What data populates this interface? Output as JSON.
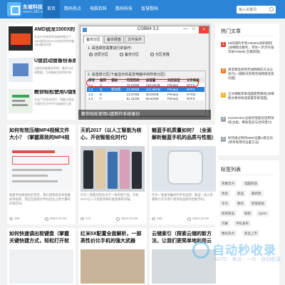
{
  "header": {
    "logo_line1": "东坡科技网",
    "logo_line2": "www.L360.cn",
    "nav": [
      "首页",
      "数码热点",
      "电脑百科",
      "数码科技",
      "智慧数码"
    ],
    "search_placeholder": "输入关键词"
  },
  "feature_list": [
    {
      "title": "AMD锐龙1500X的",
      "desc": "在芯片市场竞争加剧的情况下，AMD锐龙1500X以其出色的性能与价格比优势"
    },
    {
      "title": "U盘启动盘备份系统",
      "desc": "U盘启动盘备份系统，备份与还原数据，为电脑安全保驾护航"
    },
    {
      "title": "教你轻松使用U盘制",
      "desc": "在这个信息化时代，电脑已经成为我们生活中不可或缺的工具"
    }
  ],
  "slider": {
    "window_title": "CGB64 3.2",
    "tabs": [
      "备份分区",
      "备份硬盘",
      "文件操作"
    ],
    "step1": "1. 请选择您需要进行的操作：",
    "options": [
      "还原分区",
      "备份分区",
      "分区克隆"
    ],
    "step2": "2. 请选择分区(下面显示的是您电脑中的所有分区)",
    "table_headers": [
      "序号",
      "盘符",
      "卷标",
      "可用空间",
      "总容量",
      "分区类型",
      "文件系统"
    ],
    "table_rows": [
      [
        "1:1",
        "C:",
        "",
        "72.22GB",
        "119.01GB",
        "Primary",
        "NTFS"
      ],
      [
        "1:2",
        "D:",
        "新加卷",
        "23.05GB",
        "131.56GB",
        "Primary",
        "NTFS"
      ],
      [
        "1:3",
        "E:",
        "",
        "13.37GB",
        "30.00GB",
        "Primary",
        "FAT32"
      ],
      [
        "1:4",
        "F:",
        "",
        "51.41GB",
        "65.62GB",
        "Primary",
        "NTFS"
      ]
    ],
    "caption": "教你轻松使用U盘制作系统备份"
  },
  "sidebar": {
    "hot_title": "热门文章",
    "hot_items": [
      "58同城的手机VM590L刷机教程(详细图文解析，带你一步步升级华硕VM590L至最新版)",
      "将黑莓连接到无线网络的方法与技巧(一键解决黑莓无线网络连接问题)",
      "全文细数苹果电脑使用教程(详细图文教你快速掌握苹果电脑)",
      "H110KH911主板的性能及适用领域(主板，释放电竞与创作潜力)",
      "如何通过制作5800设置U盘启动(简单易用的设置方法)"
    ],
    "tags_title": "标签列表",
    "tags": [
      "荣耀华为",
      "电脑频道",
      "体验",
      "新品",
      "最新款",
      "华为",
      "数码",
      "智能家居",
      "新款新品",
      "联想",
      "iQOO",
      "鸿蒙",
      "手机发布",
      "数码热点",
      "新品上市"
    ]
  },
  "cards_row1": [
    {
      "title": "如何有效压缩MP4视频文件大小？（掌握高效的MP4视频压缩",
      "desc": "随着手机和相机的普及，我们越来越多地拍摄高清视频，而这些视频文件往往会占用大量的存储空间。",
      "views": "165",
      "date": "2024-10-09"
    },
    {
      "title": "天机2017（以人工智能为核心，开创智能化时代）",
      "desc": "作为一款集创新技术于一体的新产品，天机2017在人工智能领域有着重要的突破。",
      "views": "171",
      "date": "2024-10-09"
    },
    {
      "title": "魅蓝手机质量如何？（全面解析魅蓝手机的品质与性能）",
      "desc": "作为一家备受瞩目的手机品牌，魅蓝一直以来都致力于为用户提供高品质的智能手机。",
      "views": "180",
      "date": "2024-10-09"
    }
  ],
  "cards_row2": [
    {
      "title": "如何快速调出软键盘（掌握关键快捷方式，轻松打开软键盘）"
    },
    {
      "title": "红米5X配置全面解析，一部高性价比手机的强大武器（红米5X配"
    },
    {
      "title": "云储索引（探索云储的新方法，让我们更简单地利用云储）"
    }
  ],
  "watermark": {
    "line1": "自动秒收录",
    "line2": "AUTO · 来访 · 一次 · 自动收录"
  }
}
